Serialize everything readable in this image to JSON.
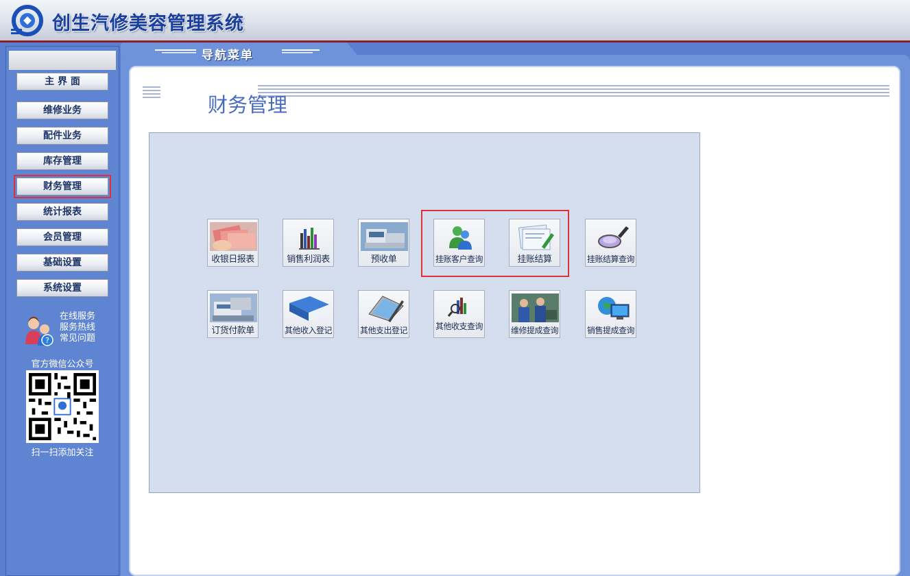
{
  "header": {
    "app_title": "创生汽修美容管理系统"
  },
  "nav_tab": {
    "label": "导航菜单"
  },
  "sidebar": {
    "items": [
      {
        "label": "主 界 面"
      },
      {
        "label": "维修业务"
      },
      {
        "label": "配件业务"
      },
      {
        "label": "库存管理"
      },
      {
        "label": "财务管理",
        "active": true
      },
      {
        "label": "统计报表"
      },
      {
        "label": "会员管理"
      },
      {
        "label": "基础设置"
      },
      {
        "label": "系统设置"
      }
    ],
    "help_links": [
      "在线服务",
      "服务热线",
      "常见问题"
    ],
    "wechat_label": "官方微信公众号",
    "qr_caption": "扫一扫添加关注"
  },
  "main": {
    "page_title": "财务管理",
    "tiles": [
      {
        "label": "收银日报表",
        "icon": "money-icon"
      },
      {
        "label": "销售利润表",
        "icon": "bar-chart-icon"
      },
      {
        "label": "预收单",
        "icon": "cash-register-icon"
      },
      {
        "label": "挂账客户查询",
        "icon": "users-icon"
      },
      {
        "label": "挂账结算",
        "icon": "document-pen-icon"
      },
      {
        "label": "挂账结算查询",
        "icon": "magnifier-icon"
      },
      {
        "label": "订货付款单",
        "icon": "payment-machine-icon"
      },
      {
        "label": "其他收入登记",
        "icon": "book-icon"
      },
      {
        "label": "其他支出登记",
        "icon": "tablet-icon"
      },
      {
        "label": "其他收支查询",
        "icon": "chart-search-icon"
      },
      {
        "label": "维修提成查询",
        "icon": "workers-icon"
      },
      {
        "label": "销售提成查询",
        "icon": "globe-monitor-icon"
      }
    ]
  }
}
